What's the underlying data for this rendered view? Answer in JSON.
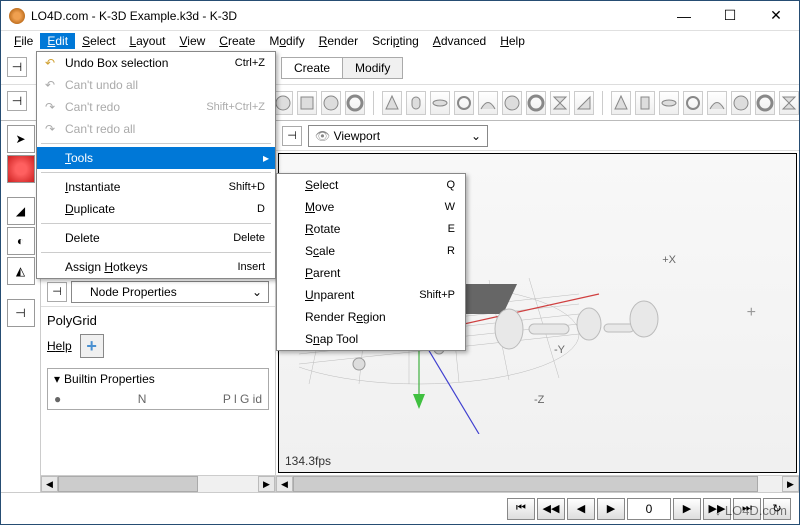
{
  "titlebar": {
    "title": "LO4D.com - K-3D Example.k3d - K-3D"
  },
  "menubar": {
    "file": "File",
    "edit": "Edit",
    "select": "Select",
    "layout": "Layout",
    "view": "View",
    "create": "Create",
    "modify": "Modify",
    "render": "Render",
    "scripting": "Scripting",
    "advanced": "Advanced",
    "help": "Help"
  },
  "edit_menu": {
    "undo": "Undo Box selection",
    "undo_sc": "Ctrl+Z",
    "cant_undo": "Can't undo all",
    "cant_redo": "Can't redo",
    "cant_redo_sc": "Shift+Ctrl+Z",
    "cant_redo_all": "Can't redo all",
    "tools": "Tools",
    "instantiate": "Instantiate",
    "instantiate_sc": "Shift+D",
    "duplicate": "Duplicate",
    "duplicate_sc": "D",
    "delete": "Delete",
    "delete_sc": "Delete",
    "hotkeys": "Assign Hotkeys",
    "hotkeys_sc": "Insert"
  },
  "tools_menu": {
    "select": "Select",
    "select_sc": "Q",
    "move": "Move",
    "move_sc": "W",
    "rotate": "Rotate",
    "rotate_sc": "E",
    "scale": "Scale",
    "scale_sc": "R",
    "parent": "Parent",
    "unparent": "Unparent",
    "unparent_sc": "Shift+P",
    "render_region": "Render Region",
    "snap": "Snap Tool"
  },
  "tabs": {
    "create": "Create",
    "modify": "Modify"
  },
  "viewport": {
    "label": "Viewport",
    "fps": "134.3fps",
    "axes": {
      "x": "+X",
      "y": "-Y",
      "z": "-Z"
    }
  },
  "panel": {
    "node_props": "Node Properties",
    "polygrid": "PolyGrid",
    "help": "Help",
    "builtin": "Builtin Properties",
    "row_name": "N",
    "row_val": "P l G id"
  },
  "status": {
    "frame": "0"
  },
  "watermark": "↓ LO4D.com"
}
